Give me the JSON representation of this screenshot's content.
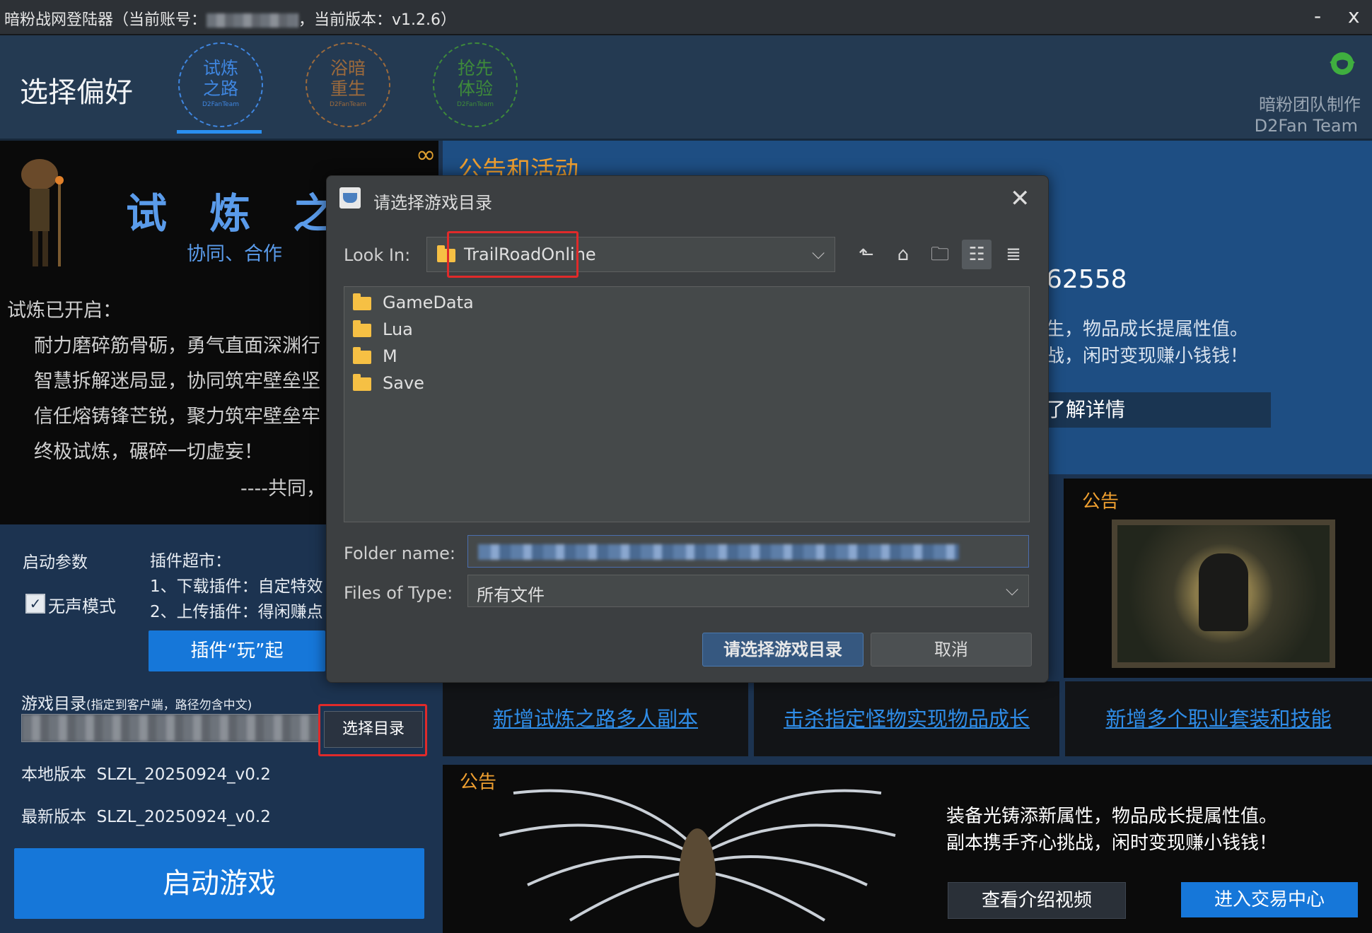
{
  "window": {
    "title_prefix": "暗粉战网登陆器（当前账号：",
    "title_suffix": "，当前版本：v1.2.6）",
    "minimize": "-",
    "close": "x"
  },
  "header": {
    "title": "选择偏好",
    "modes": [
      {
        "line1": "试炼",
        "line2": "之路",
        "tag": "D2FanTeam",
        "color": "#3f86e0"
      },
      {
        "line1": "浴暗",
        "line2": "重生",
        "tag": "D2FanTeam",
        "color": "#9c6a3c"
      },
      {
        "line1": "抢先",
        "line2": "体验",
        "tag": "D2FanTeam",
        "color": "#3e8a3a"
      }
    ],
    "team_cn": "暗粉团队制作",
    "team_en": "D2Fan Team"
  },
  "trial": {
    "infinity": "∞",
    "title": "试 炼 之 路",
    "subtitle": "协同、合作",
    "opened": "试炼已开启：",
    "lines": [
      "耐力磨碎筋骨砺，勇气直面深渊行",
      "智慧拆解迷局显，协同筑牢壁垒坚",
      "信任熔铸锋芒锐，聚力筑牢壁垒牢",
      "终极试炼，碾碎一切虚妄！"
    ],
    "signature": "----共同，"
  },
  "params": {
    "label": "启动参数",
    "silent_check": "✓",
    "silent_label": "无声模式",
    "plugin_title": "插件超市：",
    "plugin_1": "1、下载插件：自定特效",
    "plugin_2": "2、上传插件：得闲赚点",
    "plugin_button": "插件“玩”起",
    "game_dir_label": "游戏目录",
    "game_dir_hint": "(指定到客户端，路径勿含中文)",
    "choose_dir": "选择目录",
    "local_version_label": "本地版本",
    "local_version": "SLZL_20250924_v0.2",
    "latest_version_label": "最新版本",
    "latest_version": "SLZL_20250924_v0.2",
    "start_button": "启动游戏"
  },
  "announce_top": {
    "title": "公告和活动",
    "number": "62558",
    "text1": "生，物品成长提属性值。",
    "text2": "战，闲时变现赚小钱钱！",
    "more": "了解详情"
  },
  "announce_right": {
    "label": "公告"
  },
  "links": [
    "新增试炼之路多人副本",
    "击杀指定怪物实现物品成长",
    "新增多个职业套装和技能"
  ],
  "announce_bottom": {
    "label": "公告",
    "text1": "装备光铸添新属性，物品成长提属性值。",
    "text2": "副本携手齐心挑战，闲时变现赚小钱钱！",
    "video_button": "查看介绍视频",
    "trade_button": "进入交易中心"
  },
  "dialog": {
    "title": "请选择游戏目录",
    "close": "✕",
    "look_in_label": "Look In:",
    "look_in_value": "TrailRoadOnline",
    "chevron": "⌵",
    "toolbar": {
      "up": "⬑",
      "home": "⌂",
      "new_folder": "🗀",
      "list": "☷",
      "details": "≣"
    },
    "files": [
      "GameData",
      "Lua",
      "M",
      "Save"
    ],
    "folder_name_label": "Folder name:",
    "files_of_type_label": "Files of Type:",
    "files_of_type_value": "所有文件",
    "ok_button": "请选择游戏目录",
    "cancel_button": "取消"
  }
}
